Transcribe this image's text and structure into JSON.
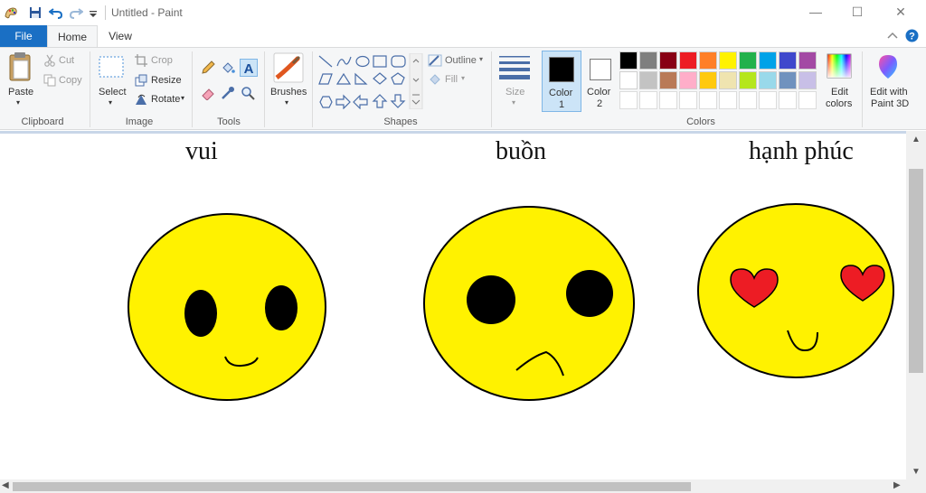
{
  "window": {
    "title": "Untitled - Paint",
    "controls": {
      "minimize": "—",
      "maximize": "☐",
      "close": "✕"
    }
  },
  "tabs": {
    "file": "File",
    "home": "Home",
    "view": "View"
  },
  "ribbon": {
    "clipboard": {
      "paste": "Paste",
      "cut": "Cut",
      "copy": "Copy",
      "group": "Clipboard"
    },
    "image": {
      "select": "Select",
      "crop": "Crop",
      "resize": "Resize",
      "rotate": "Rotate",
      "group": "Image"
    },
    "tools": {
      "group": "Tools"
    },
    "brushes": {
      "label": "Brushes"
    },
    "shapes": {
      "outline": "Outline",
      "fill": "Fill",
      "group": "Shapes"
    },
    "size": {
      "label": "Size"
    },
    "color1": {
      "label": "Color",
      "num": "1",
      "value": "#000000"
    },
    "color2": {
      "label": "Color",
      "num": "2",
      "value": "#ffffff"
    },
    "colors": {
      "group": "Colors",
      "row1": [
        "#000000",
        "#7f7f7f",
        "#880015",
        "#ed1c24",
        "#ff7f27",
        "#fff200",
        "#22b14c",
        "#00a2e8",
        "#3f48cc",
        "#a349a4"
      ],
      "row2": [
        "#ffffff",
        "#c3c3c3",
        "#b97a57",
        "#ffaec9",
        "#ffc90e",
        "#efe4b0",
        "#b5e61d",
        "#99d9ea",
        "#7092be",
        "#c8bfe7"
      ]
    },
    "edit_colors": {
      "line1": "Edit",
      "line2": "colors"
    },
    "paint3d": {
      "line1": "Edit with",
      "line2": "Paint 3D"
    }
  },
  "canvas": {
    "labels": [
      "vui",
      "buồn",
      "hạnh phúc"
    ],
    "face_color": "#fff200",
    "heart_color": "#ed1c24"
  }
}
